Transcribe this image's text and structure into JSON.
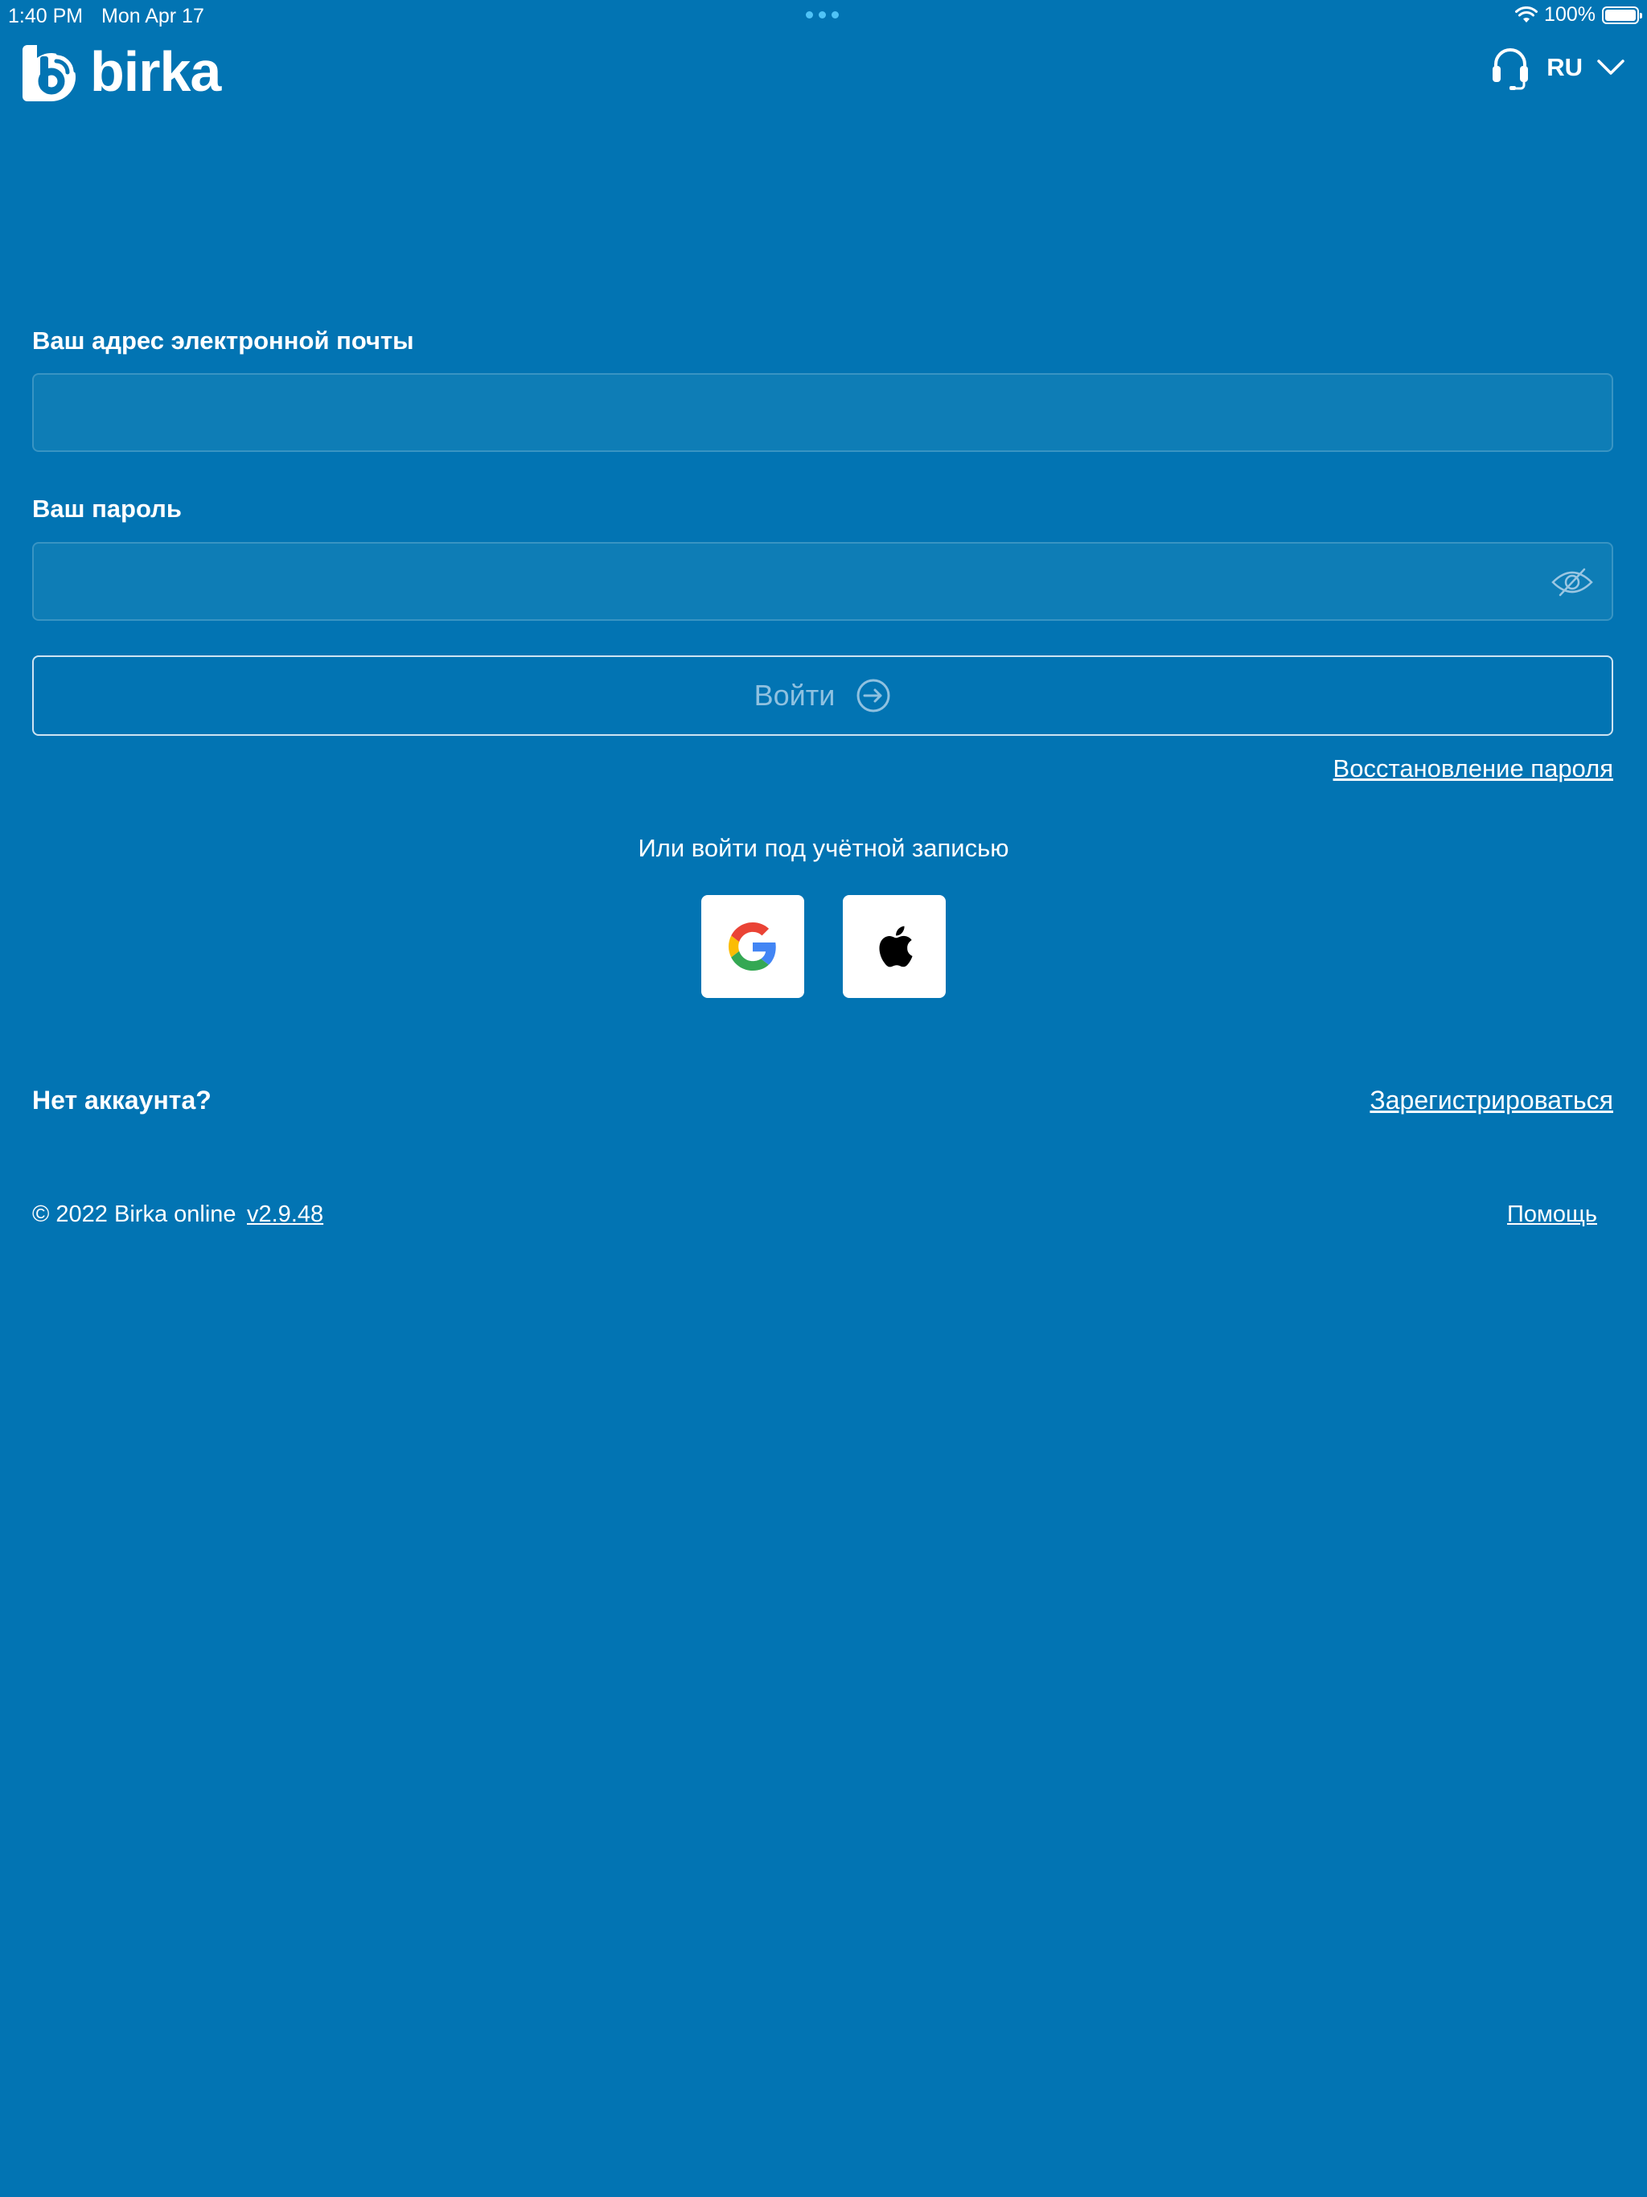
{
  "status_bar": {
    "time": "1:40 PM",
    "date": "Mon Apr 17",
    "battery": "100%",
    "icons": [
      "wifi-icon",
      "battery-icon"
    ]
  },
  "header": {
    "logo_text": "birka",
    "language": "RU",
    "icons": [
      "headset-icon",
      "chevron-down-icon"
    ]
  },
  "form": {
    "email_label": "Ваш адрес электронной почты",
    "email_value": "",
    "password_label": "Ваш пароль",
    "password_value": "",
    "login_label": "Войти",
    "restore_link": "Восстановление пароля"
  },
  "social": {
    "caption": "Или войти под учётной записью",
    "providers": [
      "google-icon",
      "apple-icon"
    ]
  },
  "register": {
    "question": "Нет аккаунта?",
    "link": "Зарегистрироваться"
  },
  "footer": {
    "copyright": "© 2022 Birka online",
    "version": "v2.9.48",
    "help": "Помощь"
  },
  "colors": {
    "background": "#0274b3",
    "field_background": "#0e7db6",
    "login_text": "#8fc1e0",
    "status_dots": "#4fc3f7"
  }
}
